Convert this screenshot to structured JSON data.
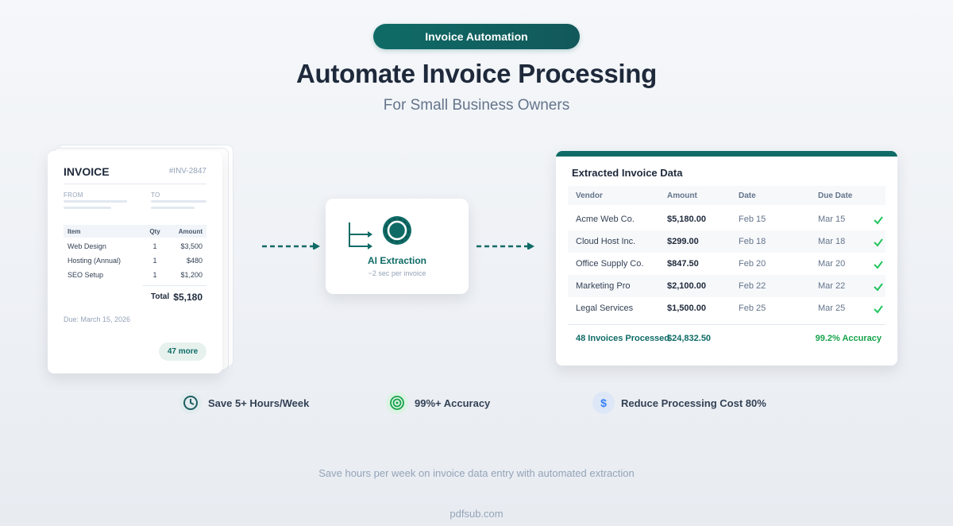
{
  "header": {
    "badge": "Invoice Automation",
    "title": "Automate Invoice Processing",
    "subtitle": "For Small Business Owners"
  },
  "invoice": {
    "title": "INVOICE",
    "number": "#INV-2847",
    "from_label": "FROM",
    "to_label": "TO",
    "columns": [
      "Item",
      "Qty",
      "Amount"
    ],
    "items": [
      {
        "item": "Web Design",
        "qty": "1",
        "amount": "$3,500"
      },
      {
        "item": "Hosting (Annual)",
        "qty": "1",
        "amount": "$480"
      },
      {
        "item": "SEO Setup",
        "qty": "1",
        "amount": "$1,200"
      }
    ],
    "total_label": "Total",
    "total_value": "$5,180",
    "due": "Due: March 15, 2026",
    "more": "47 more"
  },
  "ai": {
    "title": "AI Extraction",
    "subtitle": "~2 sec per invoice",
    "accent": "#0f6b66"
  },
  "extracted": {
    "title": "Extracted Invoice Data",
    "columns": [
      "Vendor",
      "Amount",
      "Date",
      "Due Date"
    ],
    "rows": [
      {
        "vendor": "Acme Web Co.",
        "amount": "$5,180.00",
        "date": "Feb 15",
        "due": "Mar 15",
        "icon": "check-icon"
      },
      {
        "vendor": "Cloud Host Inc.",
        "amount": "$299.00",
        "date": "Feb 18",
        "due": "Mar 18",
        "icon": "check-icon"
      },
      {
        "vendor": "Office Supply Co.",
        "amount": "$847.50",
        "date": "Feb 20",
        "due": "Mar 20",
        "icon": "check-icon"
      },
      {
        "vendor": "Marketing Pro",
        "amount": "$2,100.00",
        "date": "Feb 22",
        "due": "Mar 22",
        "icon": "check-icon"
      },
      {
        "vendor": "Legal Services",
        "amount": "$1,500.00",
        "date": "Feb 25",
        "due": "Mar 25",
        "icon": "check-icon"
      }
    ],
    "summary_count": "48 Invoices Processed",
    "summary_total": "$24,832.50",
    "summary_accuracy": "99.2% Accuracy"
  },
  "benefits": [
    {
      "icon": "clock-icon",
      "label": "Save 5+ Hours/Week"
    },
    {
      "icon": "target-icon",
      "label": "99%+ Accuracy"
    },
    {
      "icon": "dollar-icon",
      "label": "Reduce Processing Cost 80%"
    }
  ],
  "footer": {
    "note": "Save hours per week on invoice data entry with automated extraction",
    "brand": "pdfsub.com"
  },
  "colors": {
    "brand_teal": "#0f6b66",
    "success_green": "#16a34a",
    "dollar_blue": "#3b82f6"
  }
}
